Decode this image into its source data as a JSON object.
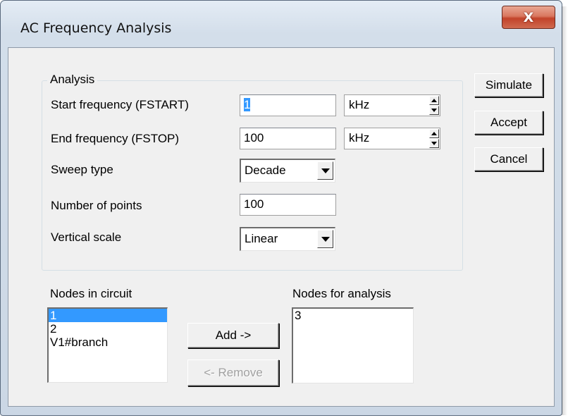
{
  "window": {
    "title": "AC Frequency Analysis",
    "close_label": "X"
  },
  "analysis": {
    "legend": "Analysis",
    "start_frequency": {
      "label": "Start frequency (FSTART)",
      "value": "1",
      "unit": "kHz"
    },
    "end_frequency": {
      "label": "End frequency (FSTOP)",
      "value": "100",
      "unit": "kHz"
    },
    "sweep_type": {
      "label": "Sweep type",
      "value": "Decade"
    },
    "number_of_points": {
      "label": "Number of points",
      "value": "100"
    },
    "vertical_scale": {
      "label": "Vertical scale",
      "value": "Linear"
    }
  },
  "buttons": {
    "simulate": "Simulate",
    "accept": "Accept",
    "cancel": "Cancel",
    "add": "Add ->",
    "remove": "<- Remove"
  },
  "nodes_in_circuit": {
    "label": "Nodes in circuit",
    "items": [
      "1",
      "2",
      "V1#branch"
    ],
    "selected_index": 0
  },
  "nodes_for_analysis": {
    "label": "Nodes for analysis",
    "items": [
      "3"
    ]
  },
  "colors": {
    "selection": "#3399ff",
    "dialog_bg": "#f0f0f0",
    "close_button": "#c2432a"
  }
}
